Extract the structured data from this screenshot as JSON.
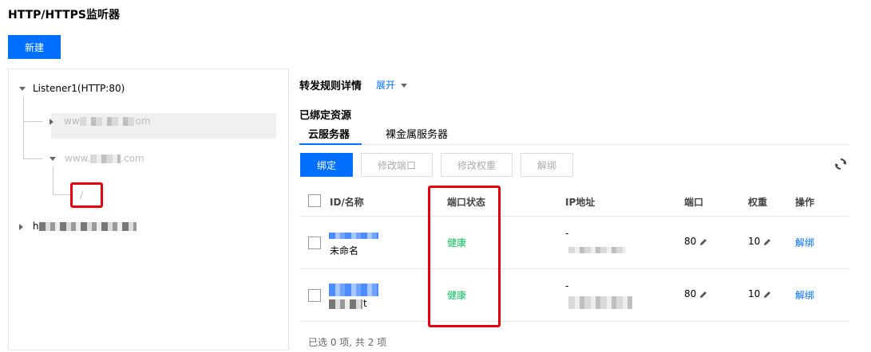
{
  "page": {
    "title": "HTTP/HTTPS监听器"
  },
  "toolbar": {
    "new_label": "新建"
  },
  "tree": {
    "listener": "Listener1(HTTP:80)",
    "domain1_prefix": "ww",
    "domain1_suffix": "om",
    "domain2_prefix": "www.",
    "domain2_suffix": ".com",
    "path": "/",
    "listener2_prefix": "h"
  },
  "detail": {
    "title": "转发规则详情",
    "expand_label": "展开"
  },
  "bound": {
    "title": "已绑定资源",
    "tabs": [
      {
        "label": "云服务器"
      },
      {
        "label": "裸金属服务器"
      }
    ],
    "actions": {
      "bind": "绑定",
      "modify_port": "修改端口",
      "modify_weight": "修改权重",
      "unbind": "解绑"
    }
  },
  "table": {
    "columns": {
      "id_name": "ID/名称",
      "port_status": "端口状态",
      "ip": "IP地址",
      "port": "端口",
      "weight": "权重",
      "ops": "操作"
    },
    "rows": [
      {
        "name": "未命名",
        "status": "健康",
        "ip_line1": "-",
        "port": "80",
        "weight": "10",
        "op": "解绑"
      },
      {
        "name_suffix": "t",
        "status": "健康",
        "ip_line1": "-",
        "port": "80",
        "weight": "10",
        "op": "解绑"
      }
    ],
    "footer": "已选 0 项, 共 2 项"
  },
  "icons": {
    "refresh": "refresh-icon",
    "edit": "pencil-icon",
    "caret": "caret-icon"
  },
  "colors": {
    "primary": "#006eff",
    "healthy": "#0abf5b",
    "highlight": "#e8000b"
  }
}
